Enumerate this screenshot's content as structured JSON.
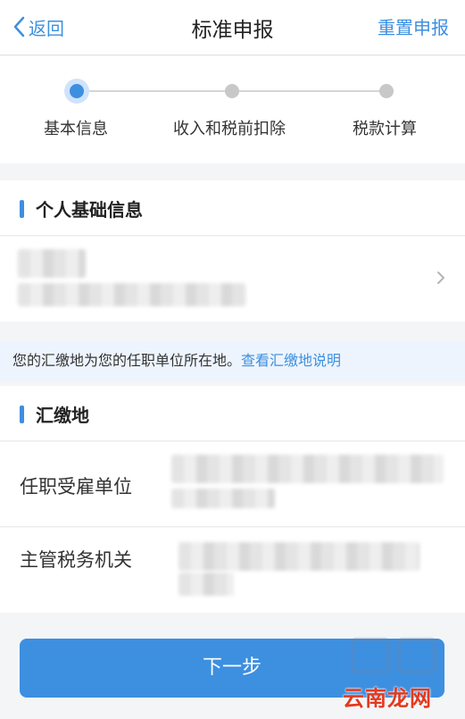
{
  "nav": {
    "back_label": "返回",
    "title": "标准申报",
    "reset_label": "重置申报"
  },
  "steps": [
    {
      "label": "基本信息",
      "active": true
    },
    {
      "label": "收入和税前扣除",
      "active": false
    },
    {
      "label": "税款计算",
      "active": false
    }
  ],
  "personal_info": {
    "heading": "个人基础信息"
  },
  "notice": {
    "text": "您的汇缴地为您的任职单位所在地。",
    "link": "查看汇缴地说明"
  },
  "filing_location": {
    "heading": "汇缴地",
    "employer_label": "任职受雇单位",
    "tax_office_label": "主管税务机关"
  },
  "next_button": "下一步",
  "watermark": {
    "text": "云南龙网"
  },
  "colors": {
    "accent": "#3d8fe0",
    "notice_bg": "#edf4fd",
    "watermark": "#e23a1f"
  }
}
